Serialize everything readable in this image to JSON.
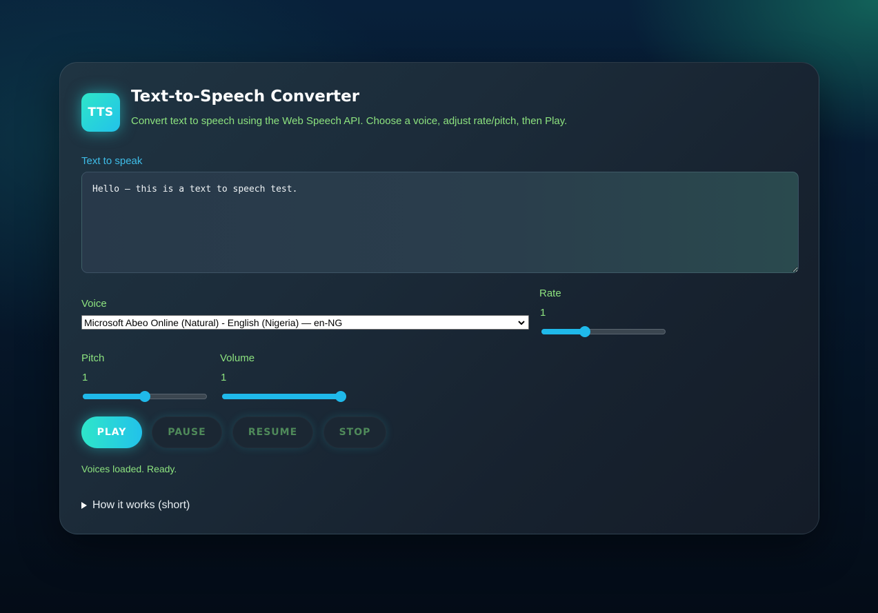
{
  "app": {
    "logo_text": "TTS",
    "title": "Text-to-Speech Converter",
    "subtitle": "Convert text to speech using the Web Speech API. Choose a voice, adjust rate/pitch, then Play."
  },
  "text_input": {
    "label": "Text to speak",
    "value": "Hello — this is a text to speech test."
  },
  "voice": {
    "label": "Voice",
    "selected": "Microsoft Abeo Online (Natural) - English (Nigeria) — en-NG"
  },
  "rate": {
    "label": "Rate",
    "value": "1",
    "fraction": 0.35
  },
  "pitch": {
    "label": "Pitch",
    "value": "1",
    "fraction": 0.5
  },
  "volume": {
    "label": "Volume",
    "value": "1",
    "fraction": 1.0
  },
  "controls": {
    "play": "PLAY",
    "pause": "PAUSE",
    "resume": "RESUME",
    "stop": "STOP"
  },
  "status": "Voices loaded. Ready.",
  "details": {
    "summary": "How it works (short)"
  },
  "colors": {
    "accent_start": "#2ee6c9",
    "accent_end": "#22c2ea",
    "label_green": "#8de37f",
    "label_blue": "#3fbde8"
  }
}
